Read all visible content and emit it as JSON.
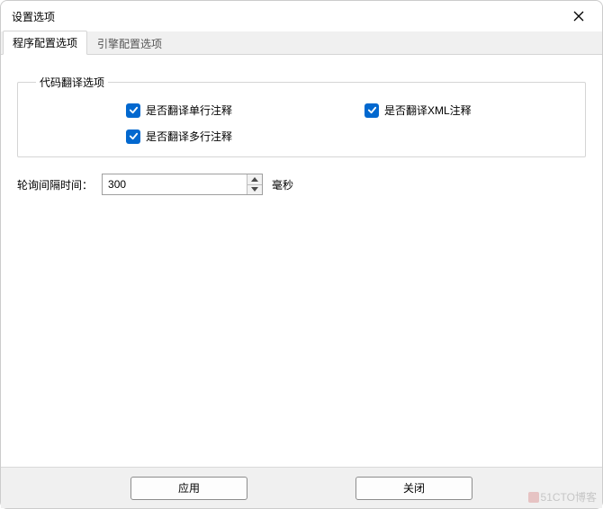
{
  "window": {
    "title": "设置选项"
  },
  "tabs": {
    "program": "程序配置选项",
    "engine": "引擎配置选项"
  },
  "group": {
    "legend": "代码翻译选项",
    "opt_single_line": "是否翻译单行注释",
    "opt_xml": "是否翻译XML注释",
    "opt_multi_line": "是否翻译多行注释"
  },
  "interval": {
    "label": "轮询间隔时间：",
    "value": "300",
    "unit": "毫秒"
  },
  "buttons": {
    "apply": "应用",
    "close": "关闭"
  },
  "watermark": "51CTO博客",
  "colors": {
    "checkbox_bg": "#0268cf"
  }
}
